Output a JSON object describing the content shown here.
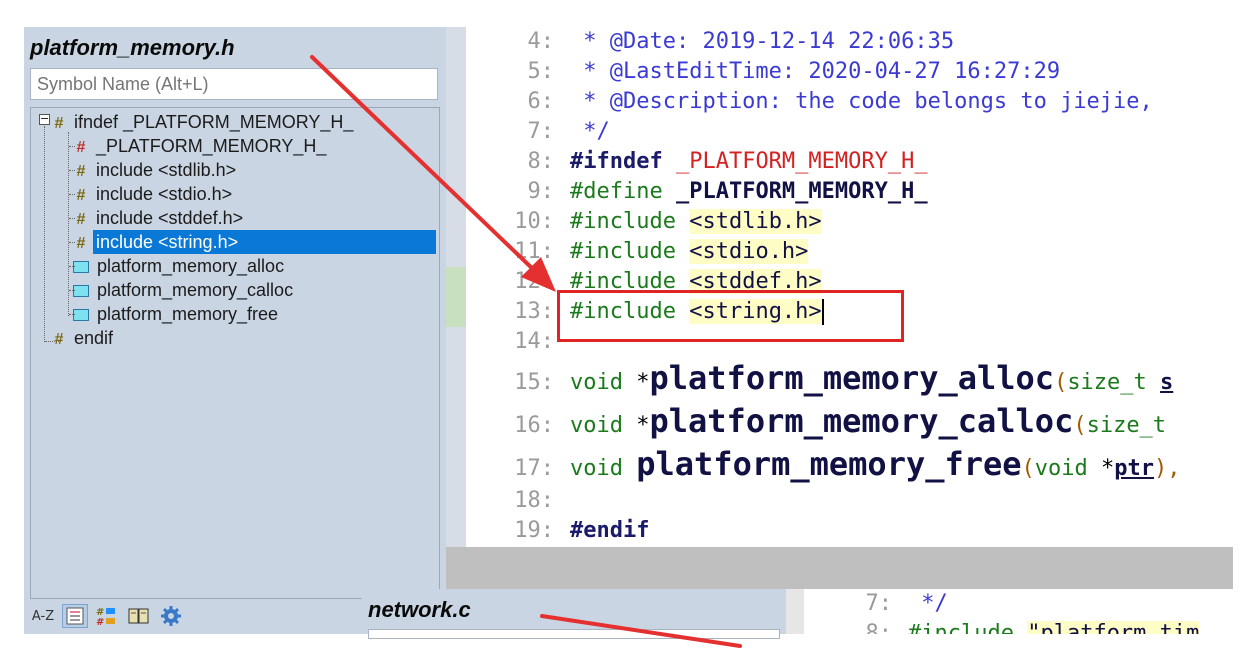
{
  "symbol_panel": {
    "title": "platform_memory.h",
    "search_placeholder": "Symbol Name (Alt+L)",
    "tree": [
      {
        "label": "ifndef _PLATFORM_MEMORY_H_",
        "icon": "hash-icon",
        "level": 0
      },
      {
        "label": "_PLATFORM_MEMORY_H_",
        "icon": "hash-red-icon",
        "level": 1
      },
      {
        "label": "include <stdlib.h>",
        "icon": "hash-icon",
        "level": 1
      },
      {
        "label": "include <stdio.h>",
        "icon": "hash-icon",
        "level": 1
      },
      {
        "label": "include <stddef.h>",
        "icon": "hash-icon",
        "level": 1
      },
      {
        "label": "include <string.h>",
        "icon": "hash-icon",
        "level": 1,
        "selected": true
      },
      {
        "label": "platform_memory_alloc",
        "icon": "function-icon",
        "level": 1
      },
      {
        "label": "platform_memory_calloc",
        "icon": "function-icon",
        "level": 1
      },
      {
        "label": "platform_memory_free",
        "icon": "function-icon",
        "level": 1
      },
      {
        "label": "endif",
        "icon": "hash-icon",
        "level": 0
      }
    ],
    "toolbar": {
      "sort_label": "A-Z",
      "icons": [
        "list-icon",
        "category-icon",
        "book-icon",
        "gear-icon"
      ]
    }
  },
  "editor": {
    "lines": [
      {
        "n": "4:",
        "parts": [
          {
            "t": " * @Date: 2019-12-14 22:06:35",
            "c": "cm"
          }
        ]
      },
      {
        "n": "5:",
        "parts": [
          {
            "t": " * @LastEditTime: 2020-04-27 16:27:29",
            "c": "cm"
          }
        ]
      },
      {
        "n": "6:",
        "parts": [
          {
            "t": " * @Description: the code belongs to jiejie,",
            "c": "cm"
          }
        ]
      },
      {
        "n": "7:",
        "parts": [
          {
            "t": " */",
            "c": "cm"
          }
        ]
      },
      {
        "n": "8:",
        "parts": [
          {
            "t": "#ifndef",
            "c": "dir"
          },
          {
            "t": " ",
            "c": ""
          },
          {
            "t": "_PLATFORM_MEMORY_H_",
            "c": "macro-r"
          }
        ]
      },
      {
        "n": "9:",
        "parts": [
          {
            "t": "#define",
            "c": "kw"
          },
          {
            "t": " ",
            "c": ""
          },
          {
            "t": "_PLATFORM_MEMORY_H_",
            "c": "macro-b"
          }
        ]
      },
      {
        "n": "10:",
        "parts": [
          {
            "t": "#include",
            "c": "kw"
          },
          {
            "t": " ",
            "c": ""
          },
          {
            "t": "<stdlib.h>",
            "c": "hdr"
          }
        ]
      },
      {
        "n": "11:",
        "parts": [
          {
            "t": "#include",
            "c": "kw"
          },
          {
            "t": " ",
            "c": ""
          },
          {
            "t": "<stdio.h>",
            "c": "hdr"
          }
        ]
      },
      {
        "n": "12:",
        "parts": [
          {
            "t": "#include",
            "c": "kw"
          },
          {
            "t": " ",
            "c": ""
          },
          {
            "t": "<stddef.h>",
            "c": "hdr"
          }
        ]
      },
      {
        "n": "13:",
        "parts": [
          {
            "t": "#include",
            "c": "kw"
          },
          {
            "t": " ",
            "c": ""
          },
          {
            "t": "<string.h>",
            "c": "hdr"
          }
        ],
        "caret": true
      },
      {
        "n": "14:",
        "parts": []
      },
      {
        "n": "15:",
        "big": true,
        "parts": [
          {
            "t": "void",
            "c": "ty"
          },
          {
            "t": " *",
            "c": ""
          },
          {
            "t": "platform_memory_alloc",
            "c": "fn"
          },
          {
            "t": "(",
            "c": "pr"
          },
          {
            "t": "size_t",
            "c": "ty"
          },
          {
            "t": " ",
            "c": ""
          },
          {
            "t": "s",
            "c": "param"
          }
        ]
      },
      {
        "n": "16:",
        "big": true,
        "parts": [
          {
            "t": "void",
            "c": "ty"
          },
          {
            "t": " *",
            "c": ""
          },
          {
            "t": "platform_memory_calloc",
            "c": "fn"
          },
          {
            "t": "(",
            "c": "pr"
          },
          {
            "t": "size_t",
            "c": "ty"
          },
          {
            "t": " ",
            "c": ""
          }
        ]
      },
      {
        "n": "17:",
        "big": true,
        "parts": [
          {
            "t": "void",
            "c": "ty"
          },
          {
            "t": " ",
            "c": ""
          },
          {
            "t": "platform_memory_free",
            "c": "fn"
          },
          {
            "t": "(",
            "c": "pr"
          },
          {
            "t": "void",
            "c": "ty"
          },
          {
            "t": " *",
            "c": ""
          },
          {
            "t": "ptr",
            "c": "param"
          },
          {
            "t": "),",
            "c": "pr"
          }
        ]
      },
      {
        "n": "18:",
        "parts": []
      },
      {
        "n": "19:",
        "parts": [
          {
            "t": "#endif",
            "c": "dir"
          }
        ]
      }
    ]
  },
  "second_window": {
    "title": "network.c",
    "lines": [
      {
        "n": "7:",
        "parts": [
          {
            "t": " */",
            "c": "cm"
          }
        ]
      },
      {
        "n": "8:",
        "parts": [
          {
            "t": "#include",
            "c": "kw"
          },
          {
            "t": " ",
            "c": ""
          },
          {
            "t": "\"platform_tim",
            "c": "hdr"
          }
        ]
      }
    ]
  },
  "colors": {
    "accent_selection": "#0a78d7",
    "annotation_red": "#e02424",
    "panel_bg": "#c9d5e2"
  }
}
